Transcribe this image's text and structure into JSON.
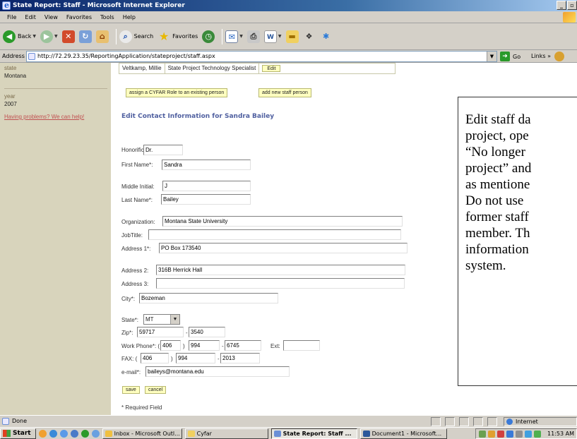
{
  "window": {
    "title": "State Report: Staff - Microsoft Internet Explorer"
  },
  "menu": [
    "File",
    "Edit",
    "View",
    "Favorites",
    "Tools",
    "Help"
  ],
  "toolbar": {
    "back_label": "Back",
    "search_label": "Search",
    "favorites_label": "Favorites"
  },
  "address": {
    "label": "Address",
    "url": "http://72.29.23.35/ReportingApplication/stateproject/staff.aspx",
    "go_label": "Go",
    "links_label": "Links »"
  },
  "sidebar": {
    "state_label": "state",
    "state_value": "Montana",
    "year_label": "year",
    "year_value": "2007",
    "help_link": "Having problems? We can help!"
  },
  "staff_row": {
    "name": "Veltkamp, Millie",
    "role": "State Project Technology Specialist",
    "edit_label": "Edit"
  },
  "actions": {
    "assign_label": "assign a CYFAR Role to an existing person",
    "add_label": "add new staff person"
  },
  "form": {
    "heading": "Edit Contact Information for Sandra Bailey",
    "honorific_label": "Honorific:",
    "honorific": "Dr.",
    "first_name_label": "First Name*:",
    "first_name": "Sandra",
    "middle_initial_label": "Middle Initial:",
    "middle_initial": "J",
    "last_name_label": "Last Name*:",
    "last_name": "Bailey",
    "organization_label": "Organization:",
    "organization": "Montana State University",
    "job_title_label": "JobTitle:",
    "job_title": "",
    "address1_label": "Address 1*:",
    "address1": "PO Box 173540",
    "address2_label": "Address 2:",
    "address2": "316B Herrick Hall",
    "address3_label": "Address 3:",
    "address3": "",
    "city_label": "City*:",
    "city": "Bozeman",
    "state_label": "State*:",
    "state": "MT",
    "zip_label": "Zip*:",
    "zip": "59717",
    "zip_sep": "-",
    "zip_ext": "3540",
    "work_phone_label": "Work Phone*: (",
    "work_area": "406",
    "work_paren": ")",
    "work_prefix": "994",
    "work_dash": "-",
    "work_line": "6745",
    "ext_label": "Ext:",
    "ext": "",
    "fax_label": "FAX: (",
    "fax_area": "406",
    "fax_paren": ")",
    "fax_prefix": "994",
    "fax_dash": "-",
    "fax_line": "2013",
    "email_label": "e-mail*:",
    "email": "baileys@montana.edu",
    "save_label": "save",
    "cancel_label": "cancel",
    "required_note": "* Required Field"
  },
  "callout": {
    "lines": [
      "Edit staff da",
      "project, ope",
      "“No longer",
      "project” and",
      "as mentione",
      "Do not use",
      "former staff",
      "member. Th",
      "information",
      "system."
    ]
  },
  "status": {
    "text": "Done",
    "zone": "Internet"
  },
  "taskbar": {
    "start_label": "Start",
    "tasks": [
      "Inbox - Microsoft Outl...",
      "Cyfar",
      "State Report: Staff ...",
      "Document1 - Microsoft..."
    ],
    "clock": "11:53 AM"
  },
  "colors": {
    "title_bar": "#0a246a",
    "sidebar_bg": "#d8d4bc",
    "heading": "#5060a0",
    "button_bg": "#ffffc0",
    "help_link": "#c05050"
  }
}
